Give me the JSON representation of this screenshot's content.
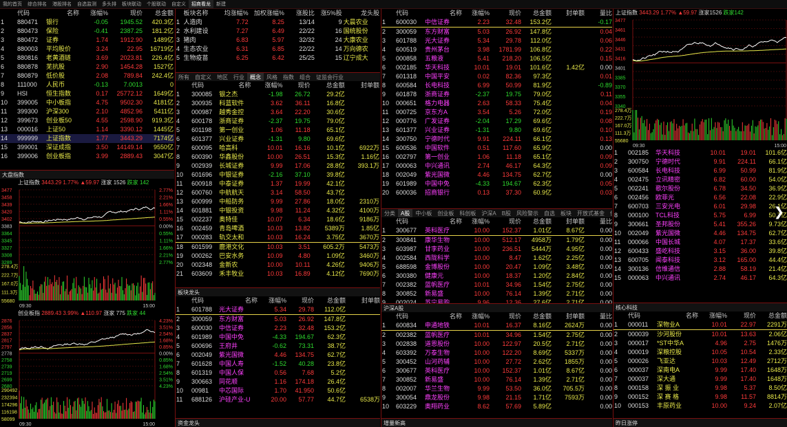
{
  "topbar": [
    "我的首页",
    "综合排名",
    "港股排名",
    "自选监测",
    "多头排",
    "板块联动",
    "个股联动",
    "自定义",
    "招商看龙",
    "新建"
  ],
  "index_list": {
    "headers": [
      "代码",
      "名称",
      "涨幅%",
      "现价",
      "总金额"
    ],
    "rows": [
      [
        "1",
        "880471",
        "银行",
        "-0.05",
        "1945.52",
        "420.3亿"
      ],
      [
        "2",
        "880473",
        "保险",
        "-0.41",
        "2387.25",
        "181.2亿"
      ],
      [
        "3",
        "880472",
        "证券",
        "1.74",
        "1912.90",
        "1489亿"
      ],
      [
        "4",
        "880003",
        "平均股价",
        "3.24",
        "22.95",
        "16719亿"
      ],
      [
        "5",
        "880816",
        "老黄酒链",
        "3.69",
        "2023.81",
        "226.4亿"
      ],
      [
        "6",
        "880878",
        "芜抗股",
        "2.90",
        "1454.28",
        "1527亿"
      ],
      [
        "7",
        "880879",
        "低价股",
        "2.08",
        "789.84",
        "242.4亿"
      ],
      [
        "8",
        "111000",
        "人民币",
        "-0.13",
        "7.0013",
        "0"
      ],
      [
        "9",
        "HSI",
        "恒生指数",
        "0.17",
        "25772.12",
        "1649亿"
      ],
      [
        "10",
        "399005",
        "中小板指",
        "4.75",
        "9502.30",
        "4181亿"
      ],
      [
        "11",
        "399300",
        "沪深300",
        "2.10",
        "4852.96",
        "5411亿"
      ],
      [
        "12",
        "399673",
        "创业板50",
        "4.55",
        "2598.90",
        "919.3亿"
      ],
      [
        "13",
        "000016",
        "上证50",
        "1.14",
        "3390.12",
        "1445亿"
      ],
      [
        "14",
        "999999",
        "上证指数",
        "1.77",
        "3443.29",
        "7174亿"
      ],
      [
        "15",
        "399001",
        "深证成指",
        "3.50",
        "14149.14",
        "9550亿"
      ],
      [
        "16",
        "399006",
        "创业板指",
        "3.99",
        "2889.43",
        "3047亿"
      ]
    ]
  },
  "sh_chart_small": {
    "title": "上证指数",
    "price": "3443.29",
    "pct": "1.77%",
    "chg": "▲59.97",
    "up": "涨家 1526",
    "down": "跌家 142",
    "y_left": [
      "3477",
      "3458",
      "3439",
      "3420",
      "3402",
      "3383",
      "3364",
      "3345",
      "3327",
      "3308",
      "3289"
    ],
    "y_right": [
      "2.77%",
      "2.21%",
      "1.66%",
      "1.11%",
      "0.55%",
      "0.00%",
      "0.55%",
      "1.11%",
      "1.66%",
      "2.21%",
      "2.77%"
    ],
    "vol": [
      "278.4万",
      "222.7万",
      "167.0万",
      "111.3万",
      "55680"
    ],
    "time": [
      "09:30",
      "15:00"
    ]
  },
  "cy_chart_small": {
    "title": "创业板指",
    "price": "2889.43",
    "pct": "3.99%",
    "chg": "▲110.97",
    "up": "涨家 775",
    "down": "跌家 44",
    "y_left": [
      "2876",
      "2856",
      "2837",
      "2817",
      "2797",
      "2778",
      "2758",
      "2739",
      "2719",
      "2699",
      "2680"
    ],
    "y_right": [
      "4.23%",
      "3.51%",
      "2.54%",
      "1.68%",
      "0.85%",
      "0.00%",
      "0.85%",
      "1.68%",
      "2.54%",
      "3.51%",
      "4.23%"
    ],
    "vol": [
      "290492",
      "232394",
      "174296",
      "116198",
      "58099"
    ],
    "time": [
      "09:30",
      "15:00"
    ]
  },
  "sector": {
    "headers": [
      "板块名称",
      "均涨幅%",
      "加权涨幅%",
      "涨股比",
      "涨5%股",
      "龙头股"
    ],
    "rows": [
      [
        "1",
        "人造肉",
        "7.72",
        "8.25",
        "13/14",
        "9",
        "大晨农业"
      ],
      [
        "2",
        "水利建设",
        "7.27",
        "6.49",
        "22/22",
        "16",
        "国统股份"
      ],
      [
        "3",
        "猪肉",
        "6.83",
        "5.97",
        "32/32",
        "24",
        "大康农业"
      ],
      [
        "4",
        "生态农业",
        "6.31",
        "6.85",
        "22/22",
        "14",
        "万向德农"
      ],
      [
        "5",
        "生物疫苗",
        "6.25",
        "6.42",
        "25/25",
        "15",
        "辽宁成大"
      ]
    ],
    "tabs": [
      "所有",
      "自定义",
      "地区",
      "行业",
      "概念",
      "风格",
      "指数",
      "组合",
      "证监会行业"
    ]
  },
  "concept": {
    "headers": [
      "代码",
      "名称",
      "涨幅%",
      "现价",
      "总金额",
      "封单额"
    ],
    "rows": [
      [
        "1",
        "300085",
        "银之杰",
        "-1.98",
        "26.72",
        "29.2亿",
        "",
        false
      ],
      [
        "2",
        "300935",
        "科蓝软件",
        "3.62",
        "36.11",
        "16.8亿",
        "",
        false
      ],
      [
        "3",
        "000987",
        "越秀金控",
        "3.64",
        "22.20",
        "30.6亿",
        "",
        false
      ],
      [
        "4",
        "600178",
        "浙商证券",
        "-2.37",
        "19.75",
        "79.0亿",
        "",
        false
      ],
      [
        "5",
        "601198",
        "第一创业",
        "1.06",
        "11.18",
        "65.1亿",
        "",
        false
      ],
      [
        "6",
        "601377",
        "兴业证券",
        "-1.31",
        "9.80",
        "69.6亿",
        "",
        false
      ],
      [
        "7",
        "600095",
        "哈高科",
        "10.01",
        "16.16",
        "10.1亿",
        "6922万",
        false
      ],
      [
        "8",
        "600390",
        "华鑫股份",
        "10.00",
        "26.51",
        "15.3亿",
        "1.16亿",
        false
      ],
      [
        "9",
        "002939",
        "长城证券",
        "9.99",
        "17.06",
        "28.8亿",
        "393.1万",
        false
      ],
      [
        "10",
        "601696",
        "中银证券",
        "-2.16",
        "37.10",
        "39.8亿",
        "",
        false
      ],
      [
        "11",
        "600918",
        "中泰证券",
        "1.37",
        "19.99",
        "42.1亿",
        "",
        false
      ],
      [
        "12",
        "600760",
        "中航航天",
        "3.14",
        "58.50",
        "43.7亿",
        "",
        false
      ],
      [
        "13",
        "600999",
        "中船防务",
        "9.99",
        "27.86",
        "18.0亿",
        "2310万",
        false
      ],
      [
        "14",
        "601881",
        "中银投资",
        "9.98",
        "11.24",
        "4.32亿",
        "4100万",
        false
      ],
      [
        "15",
        "002237",
        "奥特佳",
        "10.07",
        "6.34",
        "18.6亿",
        "9186万",
        false
      ],
      [
        "16",
        "002459",
        "青岛啤酒",
        "10.03",
        "13.82",
        "5389万",
        "1.85亿",
        false
      ],
      [
        "17",
        "000283",
        "轨交太和",
        "10.03",
        "16.24",
        "3.75亿",
        "3670万",
        false
      ],
      [
        "18",
        "601599",
        "鹿港文化",
        "10.03",
        "3.51",
        "605.2万",
        "5473万",
        false
      ],
      [
        "19",
        "000262",
        "巴安水务",
        "10.09",
        "4.80",
        "1.09亿",
        "3460万",
        false
      ],
      [
        "20",
        "002348",
        "金新农",
        "10.00",
        "10.11",
        "4.26亿",
        "9406万",
        false
      ],
      [
        "21",
        "603609",
        "禾丰牧业",
        "10.03",
        "16.89",
        "4.12亿",
        "7690万",
        false
      ]
    ]
  },
  "dragon": {
    "label": "板块龙头",
    "headers": [
      "代码",
      "名称",
      "涨幅%",
      "现价",
      "总金额",
      "封单额"
    ],
    "rows": [
      [
        "1",
        "601788",
        "光大证券",
        "5.34",
        "29.78",
        "112.0亿",
        ""
      ],
      [
        "2",
        "300059",
        "东方财富",
        "5.03",
        "26.92",
        "147.8亿",
        ""
      ],
      [
        "3",
        "600030",
        "中信证券",
        "2.23",
        "32.48",
        "153.2亿",
        ""
      ],
      [
        "4",
        "601989",
        "中国中免",
        "-4.33",
        "194.67",
        "62.3亿",
        ""
      ],
      [
        "5",
        "600696",
        "王府井",
        "-0.62",
        "73.31",
        "38.7亿",
        ""
      ],
      [
        "6",
        "002049",
        "紫光国微",
        "4.46",
        "134.75",
        "62.7亿",
        ""
      ],
      [
        "7",
        "601628",
        "中国人寿",
        "-1.52",
        "40.28",
        "23.8亿",
        ""
      ],
      [
        "8",
        "601319",
        "中国人保",
        "0.56",
        "7.68",
        "5.2亿",
        ""
      ],
      [
        "9",
        "300663",
        "同花顺",
        "1.16",
        "174.18",
        "26.4亿",
        ""
      ],
      [
        "10",
        "00981",
        "中芯国际",
        "1.70",
        "41.950",
        "50.6亿",
        ""
      ],
      [
        "11",
        "688126",
        "沪硅产业-U",
        "20.00",
        "57.77",
        "44.7亿",
        "6538万"
      ]
    ],
    "bottom": "资金龙头"
  },
  "favorites": {
    "headers": [
      "代码",
      "名称",
      "涨幅%",
      "现价",
      "总金额",
      "封单额",
      "量比"
    ],
    "rows": [
      [
        "1",
        "600030",
        "中信证券",
        "2.23",
        "32.48",
        "153.2亿",
        "",
        "-0.17"
      ],
      [
        "2",
        "300059",
        "东方财富",
        "5.03",
        "26.92",
        "147.8亿",
        "",
        "0.04"
      ],
      [
        "3",
        "601788",
        "光大证券",
        "5.34",
        "29.78",
        "112.0亿",
        "",
        "0.06"
      ],
      [
        "4",
        "600519",
        "贵州茅台",
        "3.98",
        "1781.99",
        "106.8亿",
        "",
        "0.22"
      ],
      [
        "5",
        "000858",
        "五粮液",
        "5.41",
        "218.20",
        "106.5亿",
        "",
        "0.15"
      ],
      [
        "6",
        "002185",
        "华天科技",
        "10.01",
        "19.01",
        "101.6亿",
        "1.42亿",
        "0.00"
      ],
      [
        "7",
        "601318",
        "中国平安",
        "0.02",
        "82.36",
        "97.3亿",
        "",
        "0.01"
      ],
      [
        "8",
        "600584",
        "长电科技",
        "6.99",
        "50.99",
        "81.9亿",
        "",
        "-0.89"
      ],
      [
        "9",
        "601878",
        "浙商证券",
        "-2.37",
        "19.75",
        "79.0亿",
        "",
        "0.11"
      ],
      [
        "10",
        "000651",
        "格力电器",
        "2.63",
        "58.33",
        "75.4亿",
        "",
        "0.04"
      ],
      [
        "11",
        "000725",
        "京东方A",
        "3.54",
        "5.26",
        "72.0亿",
        "",
        "0.19"
      ],
      [
        "12",
        "000776",
        "广发证券",
        "-2.04",
        "17.29",
        "69.6亿",
        "",
        "0.08"
      ],
      [
        "13",
        "601377",
        "兴业证券",
        "-1.31",
        "9.80",
        "69.6亿",
        "",
        "0.10"
      ],
      [
        "14",
        "300750",
        "宁德时代",
        "9.91",
        "224.11",
        "66.1亿",
        "",
        "0.13"
      ],
      [
        "15",
        "600536",
        "中国软件",
        "0.51",
        "117.60",
        "65.9亿",
        "",
        "0.00"
      ],
      [
        "16",
        "002797",
        "第一创业",
        "1.06",
        "11.18",
        "65.1亿",
        "",
        "0.09"
      ],
      [
        "17",
        "000063",
        "中兴通讯",
        "2.74",
        "46.17",
        "64.3亿",
        "",
        "0.09"
      ],
      [
        "18",
        "002049",
        "紫光国微",
        "4.46",
        "134.75",
        "62.7亿",
        "",
        "0.00"
      ],
      [
        "19",
        "601989",
        "中国中免",
        "-4.33",
        "194.67",
        "62.3亿",
        "",
        "0.05"
      ],
      [
        "20",
        "600036",
        "招商银行",
        "0.13",
        "37.30",
        "60.9亿",
        "",
        "0.03"
      ]
    ]
  },
  "a_share": {
    "tabs": [
      "分类",
      "A股",
      "中小板",
      "创业板",
      "科创板",
      "沪深A",
      "B股",
      "风险警示",
      "自选",
      "板块",
      "开放式基金",
      "债券",
      "港股",
      "美股"
    ],
    "headers": [
      "代码",
      "名称",
      "涨幅%",
      "现价",
      "总金额",
      "封单额",
      "量比"
    ],
    "rows": [
      [
        "1",
        "300677",
        "英科医疗",
        "10.00",
        "152.37",
        "1.01亿",
        "8.67亿",
        "0.00"
      ],
      [
        "2",
        "300841",
        "康华生物",
        "10.00",
        "512.17",
        "4958万",
        "1.79亿",
        "0.00"
      ],
      [
        "3",
        "603987",
        "甘李药业",
        "10.00",
        "236.51",
        "5444万",
        "4.95亿",
        "0.00"
      ],
      [
        "4",
        "002584",
        "西陇科学",
        "10.00",
        "8.47",
        "1.62亿",
        "2.25亿",
        "0.00"
      ],
      [
        "5",
        "688598",
        "金博股份",
        "10.00",
        "20.47",
        "1.09亿",
        "3.48亿",
        "0.00"
      ],
      [
        "6",
        "300380",
        "健康元",
        "10.00",
        "18.37",
        "1.20亿",
        "2.84亿",
        "0.00"
      ],
      [
        "7",
        "002382",
        "蓝帆医疗",
        "10.01",
        "34.96",
        "1.54亿",
        "2.75亿",
        "0.00"
      ],
      [
        "8",
        "300852",
        "新易盛",
        "10.00",
        "76.14",
        "1.39亿",
        "2.71亿",
        "0.00"
      ],
      [
        "9",
        "002024",
        "苏宁易购",
        "9.96",
        "12.36",
        "27.6亿",
        "2.71亿",
        "0.00"
      ]
    ]
  },
  "hsa": {
    "label": "沪深A股",
    "headers": [
      "代码",
      "名称",
      "涨幅%",
      "现价",
      "总金额",
      "封单额",
      "量比"
    ],
    "rows": [
      [
        "1",
        "600834",
        "申通地铁",
        "10.01",
        "16.37",
        "8.16亿",
        "2624万",
        "0.00"
      ],
      [
        "2",
        "002382",
        "蓝帆医疗",
        "10.01",
        "34.96",
        "1.54亿",
        "2.75亿",
        "0.00"
      ],
      [
        "3",
        "002838",
        "道恩股份",
        "10.00",
        "122.97",
        "20.5亿",
        "2.71亿",
        "0.00"
      ],
      [
        "4",
        "603392",
        "万泰生物",
        "10.00",
        "122.20",
        "8.69亿",
        "5337万",
        "0.00"
      ],
      [
        "5",
        "300452",
        "山河药辅",
        "10.00",
        "27.72",
        "2.62亿",
        "1855万",
        "0.00"
      ],
      [
        "6",
        "300677",
        "英科医疗",
        "10.00",
        "152.37",
        "1.01亿",
        "8.67亿",
        "0.00"
      ],
      [
        "7",
        "300852",
        "新易盛",
        "10.00",
        "76.14",
        "1.39亿",
        "2.71亿",
        "0.00"
      ],
      [
        "8",
        "002007",
        "华兰生物",
        "9.99",
        "53.50",
        "36.0亿",
        "705.5万",
        "0.00"
      ],
      [
        "9",
        "300054",
        "鼎龙股份",
        "9.98",
        "21.15",
        "1.71亿",
        "7593万",
        "0.00"
      ],
      [
        "10",
        "603229",
        "奥翔药业",
        "8.62",
        "57.69",
        "5.89亿",
        "",
        "0.00"
      ]
    ],
    "bottom": "增量新高"
  },
  "sh_chart_big": {
    "title": "上证指数",
    "price": "3443.29",
    "pct": "1.77%",
    "chg": "▲59.97",
    "up": "涨家1526",
    "down": "跌家142",
    "y_left": [
      "3477",
      "3461",
      "3446",
      "3431",
      "3416",
      "3401",
      "3385",
      "3370",
      "3355",
      "3340"
    ],
    "vol": [
      "278.4万",
      "222.7万",
      "167.0万",
      "111.3万",
      "55680"
    ],
    "time": [
      "09:30",
      "15:00"
    ]
  },
  "right_list": {
    "rows": [
      [
        "1",
        "002185",
        "华天科技",
        "10.01",
        "19.01",
        "101.6亿"
      ],
      [
        "2",
        "300750",
        "宁德时代",
        "9.91",
        "224.11",
        "66.1亿"
      ],
      [
        "3",
        "600584",
        "长电科技",
        "6.99",
        "50.99",
        "81.9亿"
      ],
      [
        "4",
        "002475",
        "立讯精密",
        "6.82",
        "60.00",
        "54.0亿"
      ],
      [
        "5",
        "002241",
        "歌尔股份",
        "6.78",
        "34.50",
        "36.9亿"
      ],
      [
        "6",
        "002456",
        "欧菲光",
        "6.56",
        "22.08",
        "22.9亿"
      ],
      [
        "7",
        "600703",
        "三安光电",
        "6.01",
        "29.98",
        "26.1亿"
      ],
      [
        "8",
        "000100",
        "TCL科技",
        "5.75",
        "6.99",
        "50.7亿"
      ],
      [
        "9",
        "300661",
        "圣邦股份",
        "5.41",
        "355.26",
        "9.73亿"
      ],
      [
        "10",
        "002049",
        "紫光国微",
        "4.46",
        "134.75",
        "62.7亿"
      ],
      [
        "11",
        "000066",
        "中国长城",
        "4.07",
        "17.37",
        "33.6亿"
      ],
      [
        "12",
        "600433",
        "盛屹科技",
        "3.15",
        "36.00",
        "39.8亿"
      ],
      [
        "13",
        "600705",
        "闻泰科技",
        "3.12",
        "165.00",
        "44.4亿"
      ],
      [
        "14",
        "300136",
        "信维通信",
        "2.88",
        "58.19",
        "21.4亿"
      ],
      [
        "15",
        "000063",
        "中兴通讯",
        "2.74",
        "46.17",
        "64.3亿"
      ]
    ]
  },
  "core": {
    "label": "核心科技",
    "headers": [
      "代码",
      "名称",
      "涨幅%",
      "现价",
      "总金额"
    ],
    "rows": [
      [
        "1",
        "000011",
        "深物业A",
        "10.01",
        "22.97",
        "2291万"
      ],
      [
        "2",
        "000039",
        "沙河股份",
        "10.01",
        "13.63",
        "2.06亿"
      ],
      [
        "3",
        "000017",
        "*ST中华A",
        "4.96",
        "2.75",
        "1476万"
      ],
      [
        "4",
        "000019",
        "深粮控股",
        "10.05",
        "10.54",
        "2.33亿"
      ],
      [
        "5",
        "000026",
        "飞亚达",
        "10.03",
        "12.49",
        "2712万"
      ],
      [
        "6",
        "000037",
        "深南电A",
        "9.99",
        "17.40",
        "1648万"
      ],
      [
        "7",
        "000037",
        "深大通",
        "9.99",
        "17.40",
        "1648万"
      ],
      [
        "8",
        "000158",
        "深 振 业",
        "9.98",
        "5.37",
        "8.50亿"
      ],
      [
        "9",
        "000152",
        "深 赛 格",
        "9.98",
        "11.57",
        "8814万"
      ],
      [
        "10",
        "000153",
        "丰原药业",
        "10.00",
        "9.24",
        "2.07亿"
      ]
    ],
    "bottom": "昨日涨停"
  },
  "colors": {
    "up": "#ff3b3b",
    "down": "#2fdc2f",
    "name": "#e8e84a",
    "border": "#7a1010"
  }
}
